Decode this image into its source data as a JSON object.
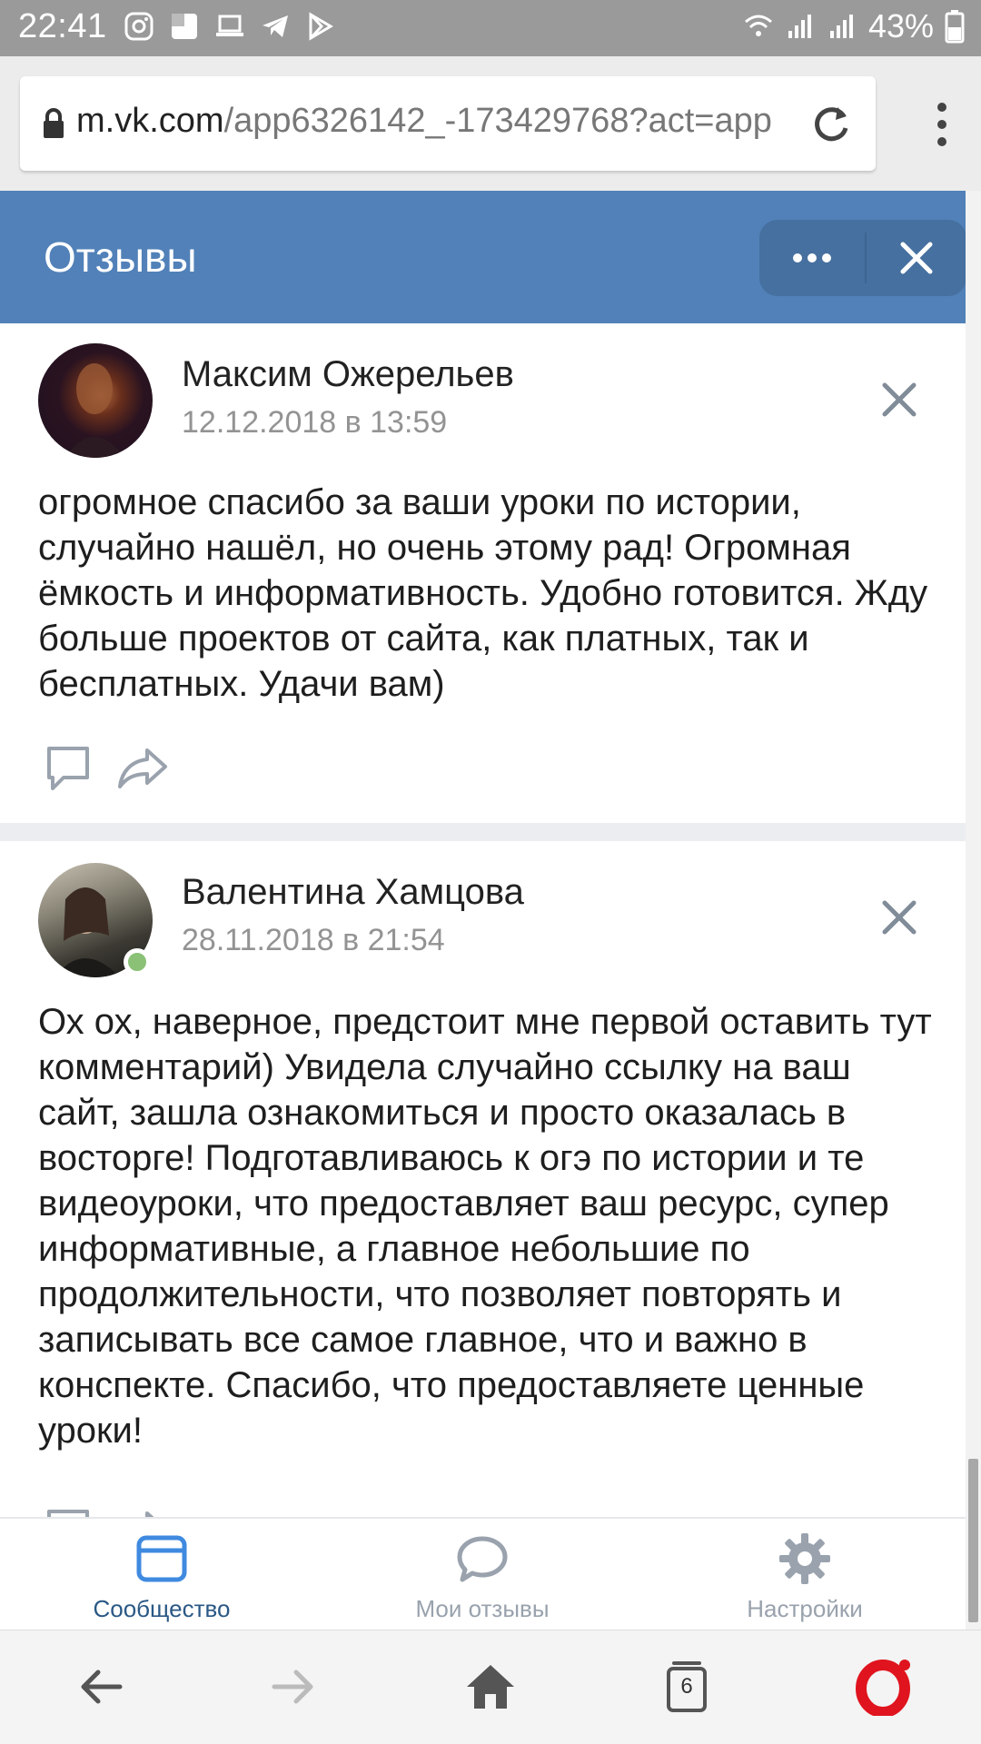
{
  "status_bar": {
    "time": "22:41",
    "battery": "43%"
  },
  "browser": {
    "url_host": "m.vk.com",
    "url_path": "/app6326142_-173429768?act=app",
    "tabs_count": "6"
  },
  "header": {
    "title": "Отзывы"
  },
  "reviews": [
    {
      "author": "Максим Ожерельев",
      "date": "12.12.2018 в 13:59",
      "text": "огромное спасибо за ваши уроки по истории, случайно нашёл, но очень этому рад! Огромная ёмкость и информативность. Удобно готовится. Жду больше проектов от сайта, как платных, так и бесплатных. Удачи вам)",
      "online": false
    },
    {
      "author": "Валентина Хамцова",
      "date": "28.11.2018 в 21:54",
      "text": "Ох ох, наверное, предстоит мне первой оставить тут комментарий) Увидела случайно ссылку на ваш сайт, зашла ознакомиться и просто оказалась в восторге! Подготавливаюсь к огэ по истории и те видеоуроки, что предоставляет ваш ресурс, супер информативные, а главное небольшие по продолжительности, что позволяет повторять и записывать все самое главное, что и важно в конспекте. Спасибо, что предоставляете ценные уроки!",
      "online": true
    }
  ],
  "tabs": [
    {
      "label": "Сообщество",
      "icon": "community-icon",
      "active": true
    },
    {
      "label": "Мои отзывы",
      "icon": "speech-bubble-icon",
      "active": false
    },
    {
      "label": "Настройки",
      "icon": "gear-icon",
      "active": false
    }
  ],
  "colors": {
    "header": "#5181b8",
    "active_tab": "#2a5885",
    "inactive_tab": "#99a2ad",
    "online": "#8ac176"
  }
}
